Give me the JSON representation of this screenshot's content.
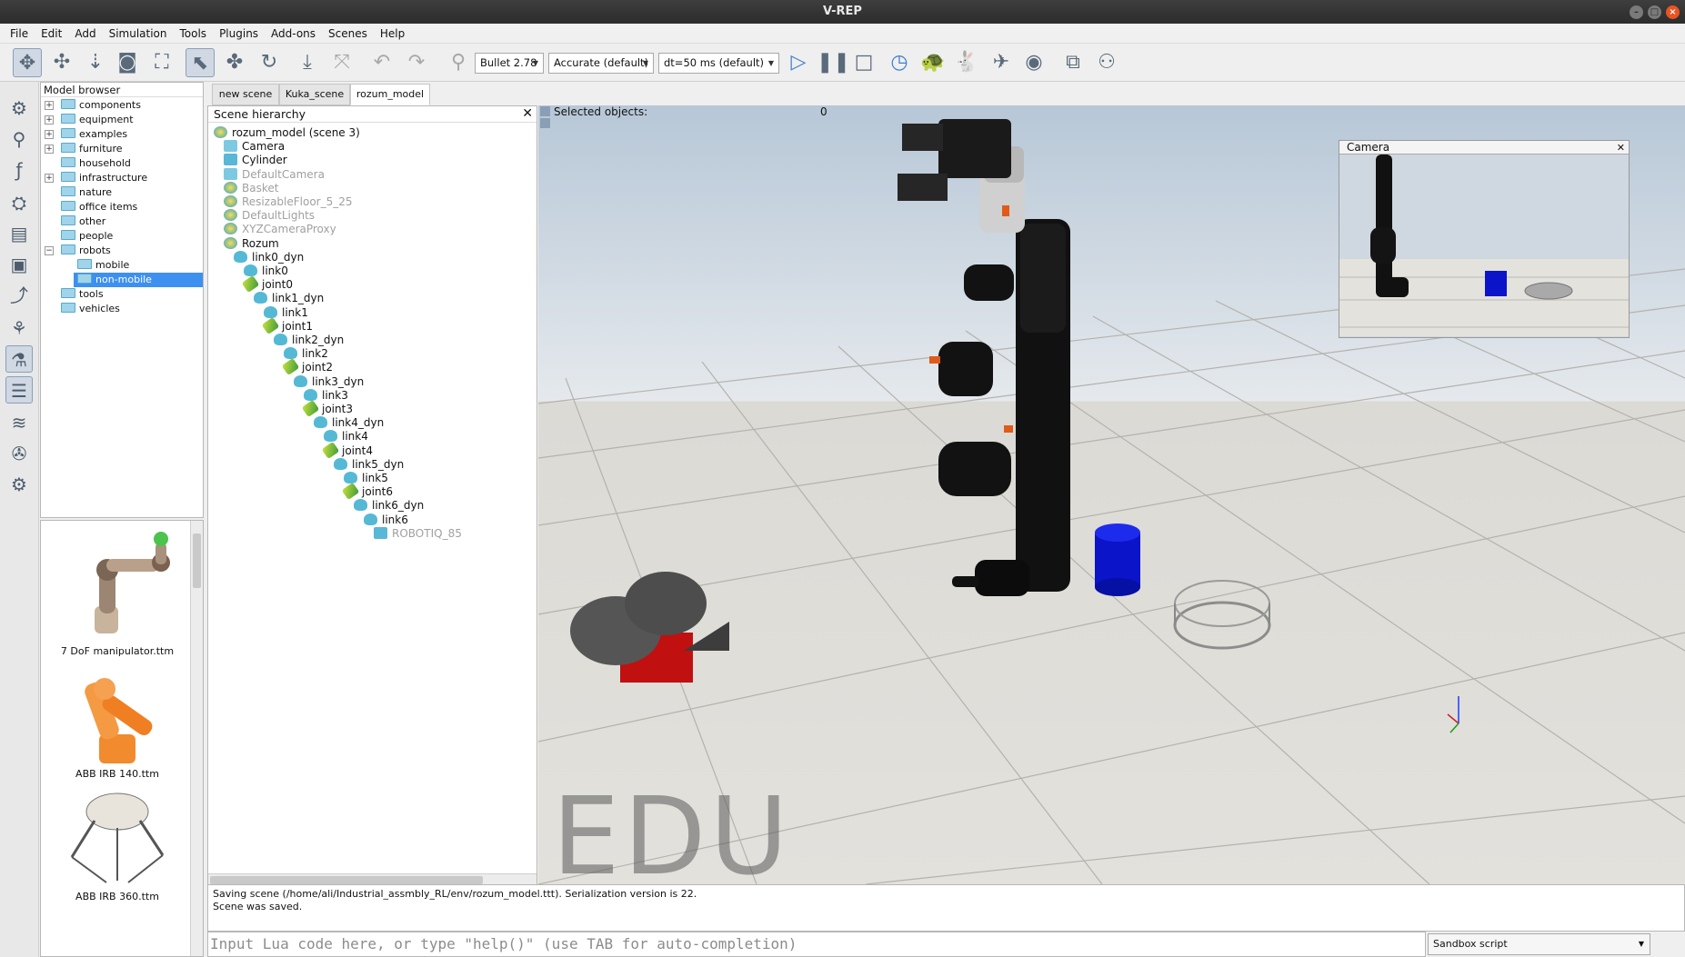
{
  "window": {
    "title": "V-REP"
  },
  "menu": [
    "File",
    "Edit",
    "Add",
    "Simulation",
    "Tools",
    "Plugins",
    "Add-ons",
    "Scenes",
    "Help"
  ],
  "toolbar": {
    "physics_engine": "Bullet 2.78",
    "accuracy": "Accurate (default)",
    "timestep": "dt=50 ms (default)"
  },
  "model_browser": {
    "title": "Model browser",
    "folders": [
      {
        "label": "components",
        "expandable": true
      },
      {
        "label": "equipment",
        "expandable": true
      },
      {
        "label": "examples",
        "expandable": true
      },
      {
        "label": "furniture",
        "expandable": true
      },
      {
        "label": "household",
        "expandable": false
      },
      {
        "label": "infrastructure",
        "expandable": true
      },
      {
        "label": "nature",
        "expandable": false
      },
      {
        "label": "office items",
        "expandable": false
      },
      {
        "label": "other",
        "expandable": false
      },
      {
        "label": "people",
        "expandable": false
      },
      {
        "label": "robots",
        "expandable": true,
        "expanded": true
      },
      {
        "label": "mobile",
        "child": true
      },
      {
        "label": "non-mobile",
        "child": true,
        "selected": true
      },
      {
        "label": "tools",
        "expandable": false
      },
      {
        "label": "vehicles",
        "expandable": false
      }
    ],
    "thumbnails": [
      "7 DoF manipulator.ttm",
      "ABB IRB 140.ttm",
      "ABB IRB 360.ttm"
    ]
  },
  "scene_tabs": [
    {
      "label": "new scene",
      "selected": false
    },
    {
      "label": "Kuka_scene",
      "selected": false
    },
    {
      "label": "rozum_model",
      "selected": true
    }
  ],
  "hierarchy": {
    "title": "Scene hierarchy",
    "items": [
      {
        "label": "rozum_model (scene 3)",
        "type": "model",
        "depth": 0
      },
      {
        "label": "Camera",
        "type": "cam",
        "depth": 1
      },
      {
        "label": "Cylinder",
        "type": "shape",
        "depth": 1
      },
      {
        "label": "DefaultCamera",
        "type": "cam",
        "depth": 1,
        "greyed": true
      },
      {
        "label": "Basket",
        "type": "model",
        "depth": 1,
        "greyed": true
      },
      {
        "label": "ResizableFloor_5_25",
        "type": "model",
        "depth": 1,
        "greyed": true
      },
      {
        "label": "DefaultLights",
        "type": "model",
        "depth": 1,
        "greyed": true
      },
      {
        "label": "XYZCameraProxy",
        "type": "model",
        "depth": 1,
        "greyed": true
      },
      {
        "label": "Rozum",
        "type": "model",
        "depth": 1
      },
      {
        "label": "link0_dyn",
        "type": "dyn",
        "depth": 2
      },
      {
        "label": "link0",
        "type": "dyn",
        "depth": 3
      },
      {
        "label": "joint0",
        "type": "joint",
        "depth": 3
      },
      {
        "label": "link1_dyn",
        "type": "dyn",
        "depth": 4
      },
      {
        "label": "link1",
        "type": "dyn",
        "depth": 5
      },
      {
        "label": "joint1",
        "type": "joint",
        "depth": 5
      },
      {
        "label": "link2_dyn",
        "type": "dyn",
        "depth": 6
      },
      {
        "label": "link2",
        "type": "dyn",
        "depth": 7
      },
      {
        "label": "joint2",
        "type": "joint",
        "depth": 7
      },
      {
        "label": "link3_dyn",
        "type": "dyn",
        "depth": 8
      },
      {
        "label": "link3",
        "type": "dyn",
        "depth": 9
      },
      {
        "label": "joint3",
        "type": "joint",
        "depth": 9
      },
      {
        "label": "link4_dyn",
        "type": "dyn",
        "depth": 10
      },
      {
        "label": "link4",
        "type": "dyn",
        "depth": 11
      },
      {
        "label": "joint4",
        "type": "joint",
        "depth": 11
      },
      {
        "label": "link5_dyn",
        "type": "dyn",
        "depth": 12
      },
      {
        "label": "link5",
        "type": "dyn",
        "depth": 13
      },
      {
        "label": "joint6",
        "type": "joint",
        "depth": 13
      },
      {
        "label": "link6_dyn",
        "type": "dyn",
        "depth": 14
      },
      {
        "label": "link6",
        "type": "dyn",
        "depth": 15
      },
      {
        "label": "ROBOTIQ_85",
        "type": "shape",
        "depth": 16,
        "greyed": true
      }
    ]
  },
  "viewport": {
    "selected_label": "Selected objects:",
    "selected_count": "0",
    "camera_window_title": "Camera",
    "watermark": "EDU"
  },
  "status": {
    "lines": [
      "Saving scene (/home/ali/Industrial_assmbly_RL/env/rozum_model.ttt). Serialization version is 22.",
      "Scene was saved."
    ]
  },
  "console": {
    "placeholder": "Input Lua code here, or type \"help()\" (use TAB for auto-completion)",
    "script_mode": "Sandbox script"
  }
}
